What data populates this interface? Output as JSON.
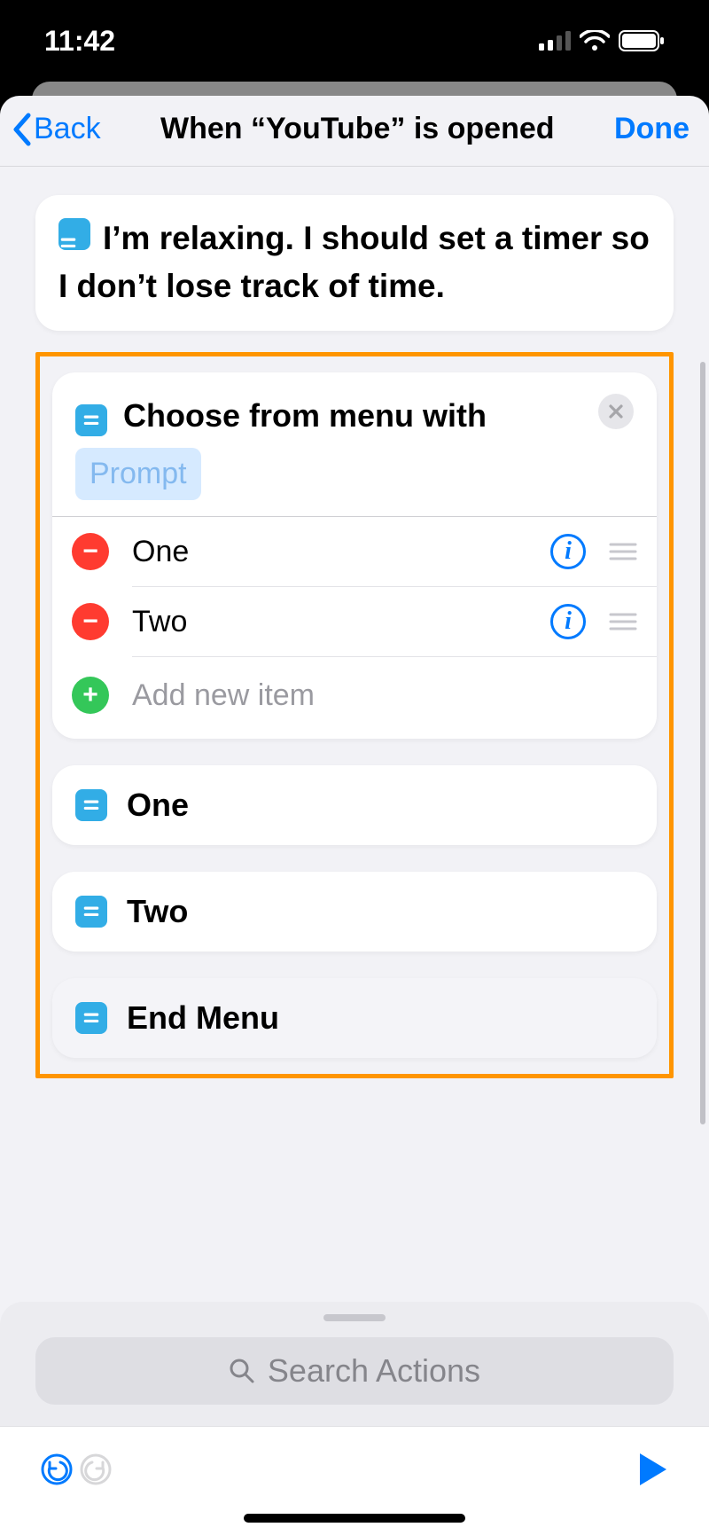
{
  "status": {
    "time": "11:42"
  },
  "nav": {
    "back": "Back",
    "title": "When “YouTube” is opened",
    "done": "Done"
  },
  "actions": {
    "text_block": "I’m relaxing. I should set a timer so I don’t lose track of time.",
    "choose_menu": {
      "label": "Choose from menu with",
      "prompt_token": "Prompt",
      "items": [
        "One",
        "Two"
      ],
      "add_placeholder": "Add new item"
    },
    "results": [
      "One",
      "Two",
      "End Menu"
    ]
  },
  "search": {
    "placeholder": "Search Actions"
  },
  "colors": {
    "accent": "#007aff",
    "highlight": "#ff9500"
  }
}
